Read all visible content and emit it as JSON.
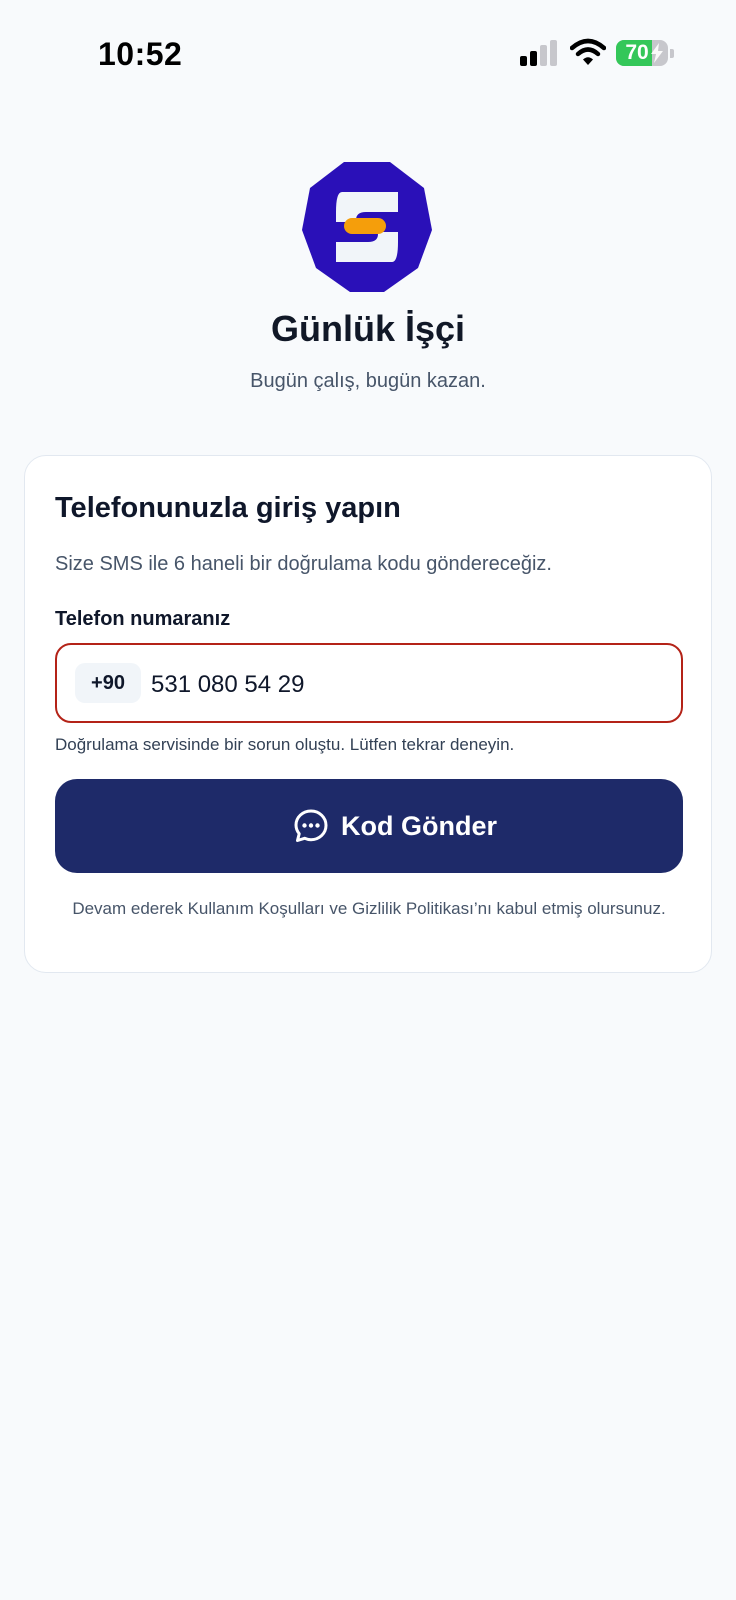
{
  "status_bar": {
    "time": "10:52",
    "battery_level": "70",
    "battery_fraction": 0.7,
    "icons": [
      "cellular-signal-icon",
      "wifi-icon",
      "battery-charging-icon"
    ]
  },
  "app": {
    "title": "Günlük İşçi",
    "tagline": "Bugün çalış, bugün kazan.",
    "logo_icon": "app-logo-icon",
    "colors": {
      "brand_blue": "#2a10b8",
      "accent_orange": "#f59e0b",
      "button_navy": "#1e2a69",
      "error_border": "#b42318"
    }
  },
  "login_card": {
    "title": "Telefonunuzla giriş yapın",
    "description": "Size SMS ile 6 haneli bir doğrulama kodu göndereceğiz.",
    "phone_label": "Telefon numaranız",
    "country_code": "+90",
    "phone_value": "531 080 54 29",
    "error_message": "Doğrulama servisinde bir sorun oluştu. Lütfen tekrar deneyin.",
    "send_button_label": "Kod Gönder",
    "send_button_icon": "chat-bubble-icon",
    "legal_text": "Devam ederek Kullanım Koşulları ve Gizlilik Politikası’nı kabul etmiş olursunuz."
  }
}
